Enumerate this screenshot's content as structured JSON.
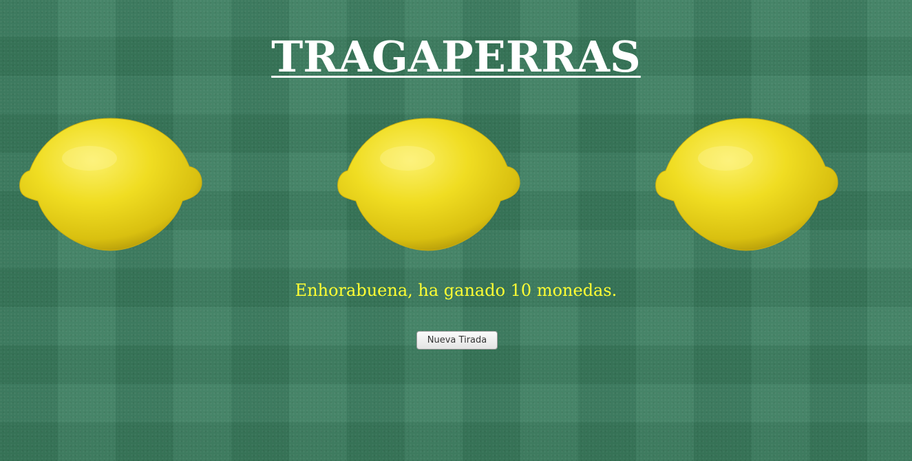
{
  "title": "TRAGAPERRAS",
  "reels": [
    {
      "symbol": "lemon-icon"
    },
    {
      "symbol": "lemon-icon"
    },
    {
      "symbol": "lemon-icon"
    }
  ],
  "message": "Enhorabuena, ha ganado 10 monedas.",
  "spin_button_label": "Nueva Tirada",
  "colors": {
    "background": "#3a7c5e",
    "title": "#ffffff",
    "message": "#ffff33",
    "lemon": "#f3e02a"
  }
}
